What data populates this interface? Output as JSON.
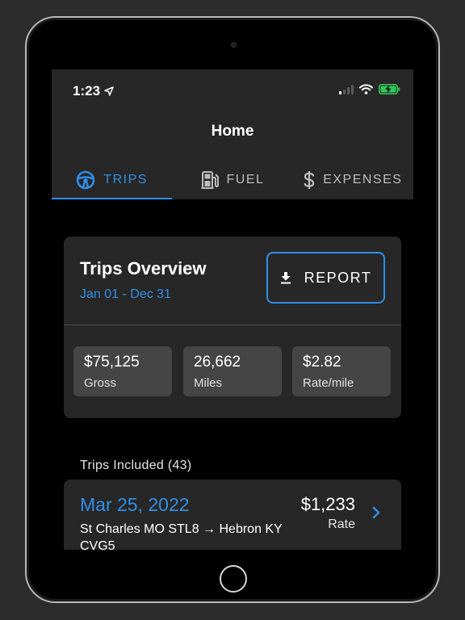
{
  "status_bar": {
    "time": "1:23"
  },
  "header": {
    "title": "Home"
  },
  "tabs": [
    {
      "label": "TRIPS",
      "icon": "steering-wheel-icon",
      "active": true
    },
    {
      "label": "FUEL",
      "icon": "fuel-pump-icon",
      "active": false
    },
    {
      "label": "EXPENSES",
      "icon": "dollar-icon",
      "active": false
    }
  ],
  "overview": {
    "title": "Trips Overview",
    "date_range": "Jan 01 - Dec 31",
    "report_label": "REPORT",
    "stats": [
      {
        "value": "$75,125",
        "label": "Gross"
      },
      {
        "value": "26,662",
        "label": "Miles"
      },
      {
        "value": "$2.82",
        "label": "Rate/mile"
      }
    ]
  },
  "trips_section": {
    "label": "Trips Included (43)",
    "items": [
      {
        "date": "Mar 25, 2022",
        "route": "St Charles MO STL8 → Hebron KY CVG5",
        "amount": "$1,233",
        "amount_label": "Rate"
      }
    ]
  },
  "colors": {
    "accent": "#2f8fe8",
    "surface": "#272727",
    "stat_tile": "#454545",
    "background": "#000000"
  }
}
